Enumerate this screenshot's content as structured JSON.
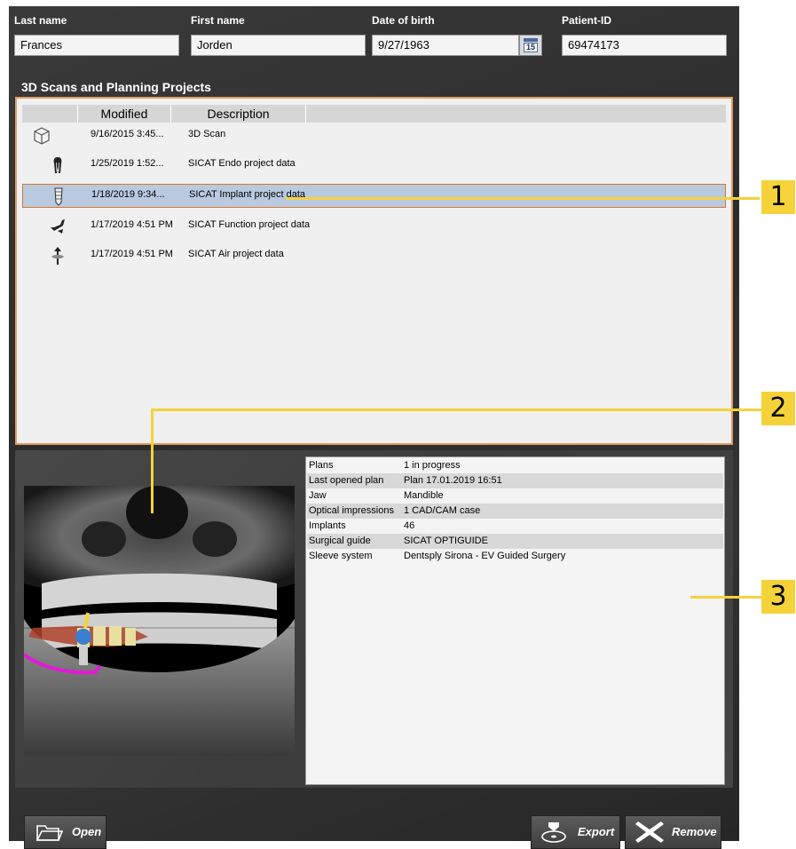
{
  "patient": {
    "last_name_label": "Last name",
    "last_name_value": "Frances",
    "first_name_label": "First name",
    "first_name_value": "Jorden",
    "dob_label": "Date of birth",
    "dob_value": "9/27/1963",
    "calendar_day": "15",
    "id_label": "Patient-ID",
    "id_value": "69474173"
  },
  "projects": {
    "title": "3D Scans and Planning Projects",
    "columns": [
      "",
      "Modified",
      "Description"
    ],
    "rows": [
      {
        "icon": "cube-scan-icon",
        "modified": "9/16/2015 3:45...",
        "description": "3D Scan"
      },
      {
        "icon": "tooth-endo-icon",
        "modified": "1/25/2019 1:52...",
        "description": "SICAT Endo project data"
      },
      {
        "icon": "implant-icon",
        "modified": "1/18/2019 9:34...",
        "description": "SICAT Implant project data",
        "selected": true
      },
      {
        "icon": "jaw-function-icon",
        "modified": "1/17/2019 4:51 PM",
        "description": "SICAT Function project data"
      },
      {
        "icon": "airway-icon",
        "modified": "1/17/2019 4:51 PM",
        "description": "SICAT Air project data"
      }
    ]
  },
  "details": [
    {
      "key": "Plans",
      "value": "1 in progress"
    },
    {
      "key": "Last opened plan",
      "value": "Plan 17.01.2019 16:51"
    },
    {
      "key": "Jaw",
      "value": "Mandible"
    },
    {
      "key": "Optical impressions",
      "value": "1 CAD/CAM case"
    },
    {
      "key": "Implants",
      "value": "46"
    },
    {
      "key": "Surgical guide",
      "value": "SICAT OPTIGUIDE"
    },
    {
      "key": "Sleeve system",
      "value": "Dentsply Sirona - EV Guided Surgery"
    }
  ],
  "buttons": {
    "open": "Open",
    "export": "Export",
    "remove": "Remove"
  },
  "callouts": [
    "1",
    "2",
    "3"
  ],
  "colors": {
    "callout": "#f5d23a",
    "selection_border": "#d9772b",
    "selection_fill": "#b9c9e0"
  }
}
